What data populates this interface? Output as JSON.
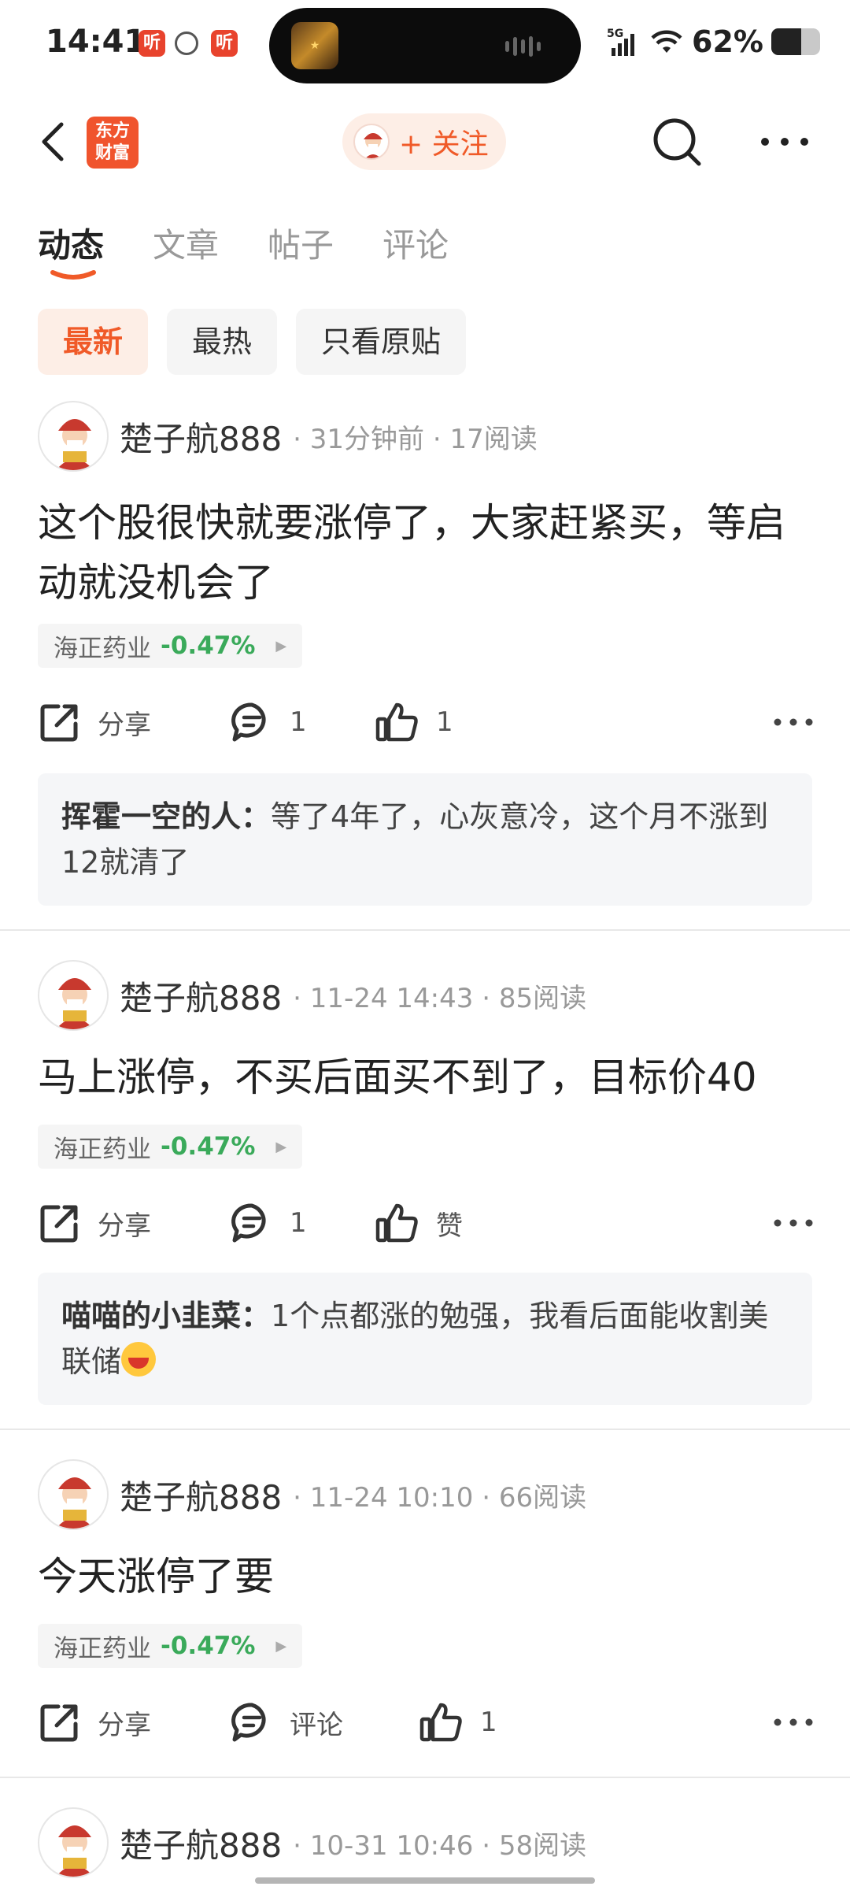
{
  "status_bar": {
    "time": "14:41",
    "app_icons": [
      "听",
      "听"
    ],
    "network": "5G",
    "battery_percent_text": "62%",
    "battery_level": 0.62
  },
  "header": {
    "logo_text_line1": "东方",
    "logo_text_line2": "财富",
    "follow_label": "+ 关注"
  },
  "tabs": [
    {
      "label": "动态",
      "active": true
    },
    {
      "label": "文章",
      "active": false
    },
    {
      "label": "帖子",
      "active": false
    },
    {
      "label": "评论",
      "active": false
    }
  ],
  "filters": [
    {
      "label": "最新",
      "active": true
    },
    {
      "label": "最热",
      "active": false
    },
    {
      "label": "只看原贴",
      "active": false
    }
  ],
  "posts": [
    {
      "author": "楚子航888",
      "time": "31分钟前",
      "reads": "17阅读",
      "text": "这个股很快就要涨停了，大家赶紧买，等启动就没机会了",
      "stock": {
        "name": "海正药业",
        "change": "-0.47%"
      },
      "share_label": "分享",
      "comment_label": "1",
      "like_label": "1",
      "reply": {
        "user": "挥霍一空的人：",
        "text": "等了4年了，心灰意冷，这个月不涨到12就清了"
      }
    },
    {
      "author": "楚子航888",
      "time": "11-24 14:43",
      "reads": "85阅读",
      "text": "马上涨停，不买后面买不到了，目标价40",
      "stock": {
        "name": "海正药业",
        "change": "-0.47%"
      },
      "share_label": "分享",
      "comment_label": "1",
      "like_label": "赞",
      "reply": {
        "user": "喵喵的小韭菜：",
        "text": "1个点都涨的勉强，我看后面能收割美联储"
      }
    },
    {
      "author": "楚子航888",
      "time": "11-24 10:10",
      "reads": "66阅读",
      "text": "今天涨停了要",
      "stock": {
        "name": "海正药业",
        "change": "-0.47%"
      },
      "share_label": "分享",
      "comment_label": "评论",
      "like_label": "1"
    },
    {
      "author": "楚子航888",
      "time": "10-31 10:46",
      "reads": "58阅读"
    }
  ],
  "colors": {
    "accent": "#f05a28",
    "stock_down": "#3aaa5a",
    "reply_bg": "#f5f6f8"
  }
}
